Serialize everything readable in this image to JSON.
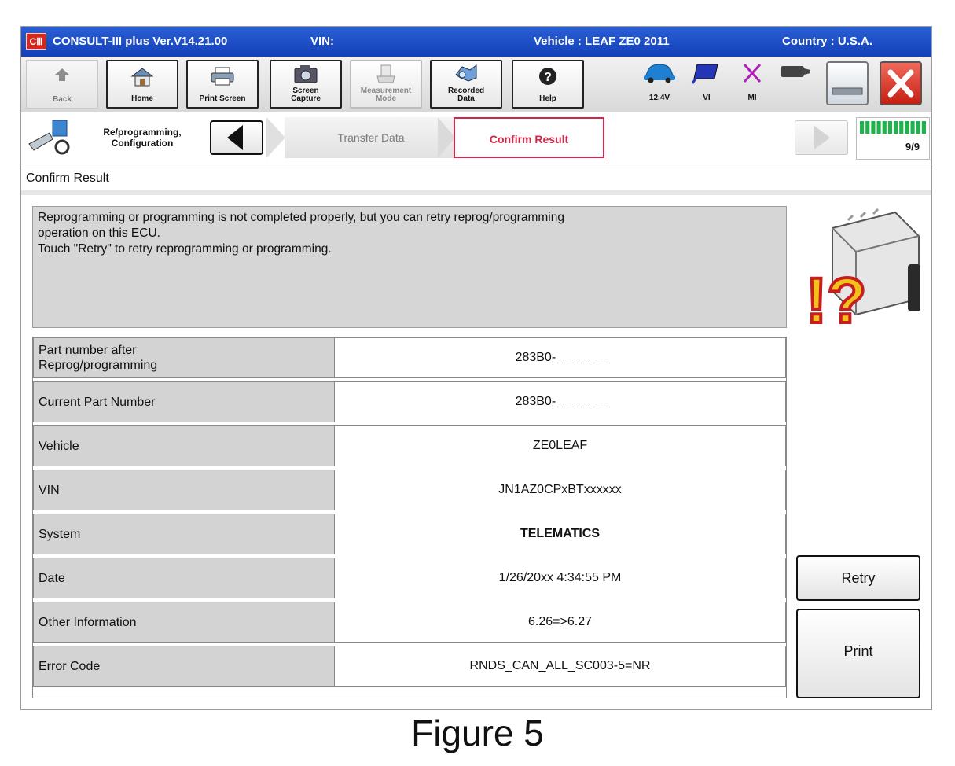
{
  "titlebar": {
    "app_title": "CONSULT-III plus  Ver.V14.21.00",
    "vin_label": "VIN:",
    "vehicle": "Vehicle : LEAF ZE0 2011",
    "country": "Country : U.S.A.",
    "logo_text": "CⅢ"
  },
  "toolbar": {
    "back": "Back",
    "home": "Home",
    "print_screen": "Print Screen",
    "screen_capture_1": "Screen",
    "screen_capture_2": "Capture",
    "measurement_1": "Measurement",
    "measurement_2": "Mode",
    "recorded_1": "Recorded",
    "recorded_2": "Data",
    "help": "Help",
    "voltage": "12.4V",
    "vi": "VI",
    "mi": "MI"
  },
  "nav": {
    "title_1": "Re/programming,",
    "title_2": "Configuration",
    "step_transfer": "Transfer Data",
    "step_confirm": "Confirm Result",
    "progress": "9/9",
    "progress_fraction": 1.0
  },
  "section_label": "Confirm Result",
  "message": {
    "line1": "Reprogramming or programming is not completed properly, but you can retry reprog/programming",
    "line2": "operation on this ECU.",
    "line3": "Touch \"Retry\" to retry reprogramming or programming."
  },
  "table": {
    "rows": [
      {
        "label_1": "Part number after",
        "label_2": "Reprog/programming",
        "value": "283B0-_ _ _ _ _"
      },
      {
        "label": "Current Part Number",
        "value": "283B0-_ _ _ _ _"
      },
      {
        "label": "Vehicle",
        "value": "ZE0LEAF"
      },
      {
        "label": "VIN",
        "value": "JN1AZ0CPxBTxxxxxx"
      },
      {
        "label": "System",
        "value": "TELEMATICS"
      },
      {
        "label": "Date",
        "value": "1/26/20xx 4:34:55 PM"
      },
      {
        "label": "Other Information",
        "value": "6.26=>6.27"
      },
      {
        "label": "Error Code",
        "value": "RNDS_CAN_ALL_SC003-5=NR"
      }
    ]
  },
  "buttons": {
    "retry": "Retry",
    "print": "Print"
  },
  "caption": "Figure 5",
  "colors": {
    "titlebar": "#1f4fc9",
    "confirm_accent": "#d2264a",
    "progress": "#22b14c",
    "warning_fill": "#f2c21a",
    "warning_outline": "#c81e1e"
  },
  "icons": [
    "back-arrow-icon",
    "home-icon",
    "printer-icon",
    "camera-icon",
    "measurement-icon",
    "recorded-data-icon",
    "help-icon",
    "car-battery-icon",
    "vi-icon",
    "mi-icon",
    "vehicle-icon",
    "window-minimize-icon",
    "window-close-icon",
    "reprogramming-icon",
    "previous-arrow-icon",
    "next-arrow-icon",
    "ecu-warning-icon"
  ]
}
